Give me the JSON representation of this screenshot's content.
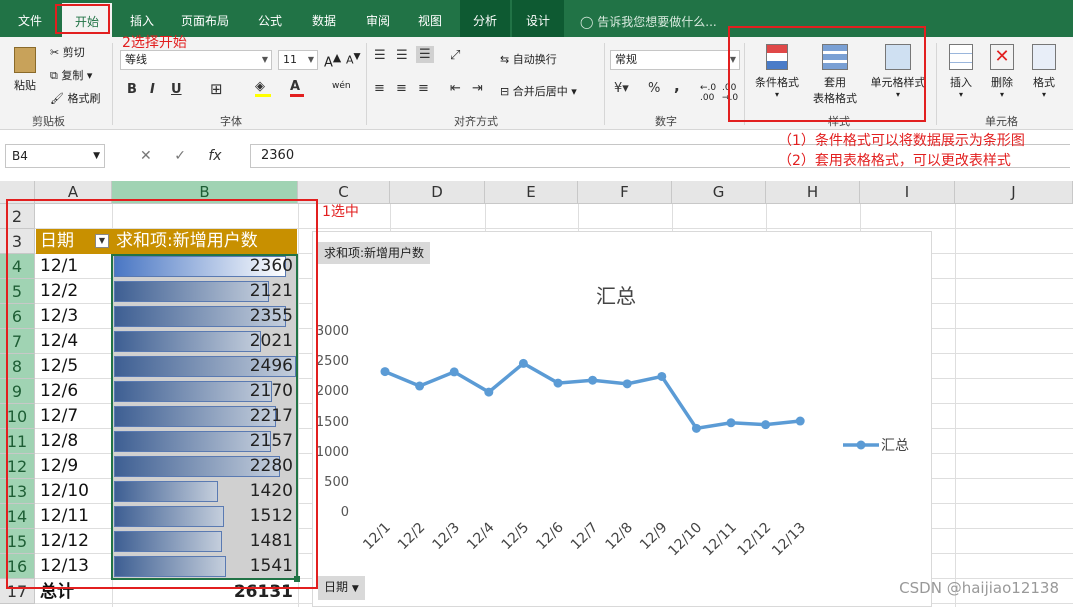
{
  "tabs": [
    "文件",
    "开始",
    "插入",
    "页面布局",
    "公式",
    "数据",
    "审阅",
    "视图",
    "分析",
    "设计"
  ],
  "tell_me": "告诉我您想要做什么...",
  "clipboard": {
    "paste": "粘贴",
    "cut": "剪切",
    "copy": "复制",
    "format_painter": "格式刷",
    "label": "剪贴板"
  },
  "font": {
    "name": "等线",
    "size": "11",
    "label": "字体",
    "bold": "B",
    "italic": "I",
    "underline": "U",
    "phonetic": "wén"
  },
  "alignment": {
    "wrap": "自动换行",
    "merge": "合并后居中",
    "label": "对齐方式"
  },
  "number": {
    "format": "常规",
    "label": "数字",
    "percent": "%",
    "comma": ","
  },
  "styles": {
    "conditional": "条件格式",
    "table_format_1": "套用",
    "table_format_2": "表格格式",
    "cell_styles": "单元格样式",
    "label": "样式"
  },
  "cells": {
    "insert": "插入",
    "delete": "删除",
    "format": "格式",
    "label": "单元格"
  },
  "name_box": "B4",
  "formula_value": "2360",
  "columns": [
    "A",
    "B",
    "C",
    "D",
    "E",
    "F",
    "G",
    "H",
    "I",
    "J"
  ],
  "rows": [
    "2",
    "3",
    "4",
    "5",
    "6",
    "7",
    "8",
    "9",
    "10",
    "11",
    "12",
    "13",
    "14",
    "15",
    "16",
    "17"
  ],
  "pivot": {
    "header_date": "日期",
    "header_sum": "求和项:新增用户数",
    "dates": [
      "12/1",
      "12/2",
      "12/3",
      "12/4",
      "12/5",
      "12/6",
      "12/7",
      "12/8",
      "12/9",
      "12/10",
      "12/11",
      "12/12",
      "12/13"
    ],
    "values": [
      2360,
      2121,
      2355,
      2021,
      2496,
      2170,
      2217,
      2157,
      2280,
      1420,
      1512,
      1481,
      1541
    ],
    "total_label": "总计",
    "total_value": "26131"
  },
  "chart_data": {
    "type": "line",
    "title": "汇总",
    "field_button": "求和项:新增用户数",
    "axis_field_button": "日期",
    "categories": [
      "12/1",
      "12/2",
      "12/3",
      "12/4",
      "12/5",
      "12/6",
      "12/7",
      "12/8",
      "12/9",
      "12/10",
      "12/11",
      "12/12",
      "12/13"
    ],
    "series": [
      {
        "name": "汇总",
        "values": [
          2360,
          2121,
          2355,
          2021,
          2496,
          2170,
          2217,
          2157,
          2280,
          1420,
          1512,
          1481,
          1541
        ]
      }
    ],
    "ylim": [
      0,
      3000
    ],
    "yticks": [
      0,
      500,
      1000,
      1500,
      2000,
      2500,
      3000
    ],
    "legend": "right",
    "color": "#5b9bd5"
  },
  "annotations": {
    "select": "1选中",
    "start": "2选择开始",
    "note1": "（1）条件格式可以将数据展示为条形图",
    "note2": "（2）套用表格格式，可以更改表样式"
  },
  "watermark": "CSDN @haijiao12138",
  "colors": {
    "accent": "#217346",
    "annotation": "#e21f1f",
    "pivot_header": "#c89000"
  }
}
